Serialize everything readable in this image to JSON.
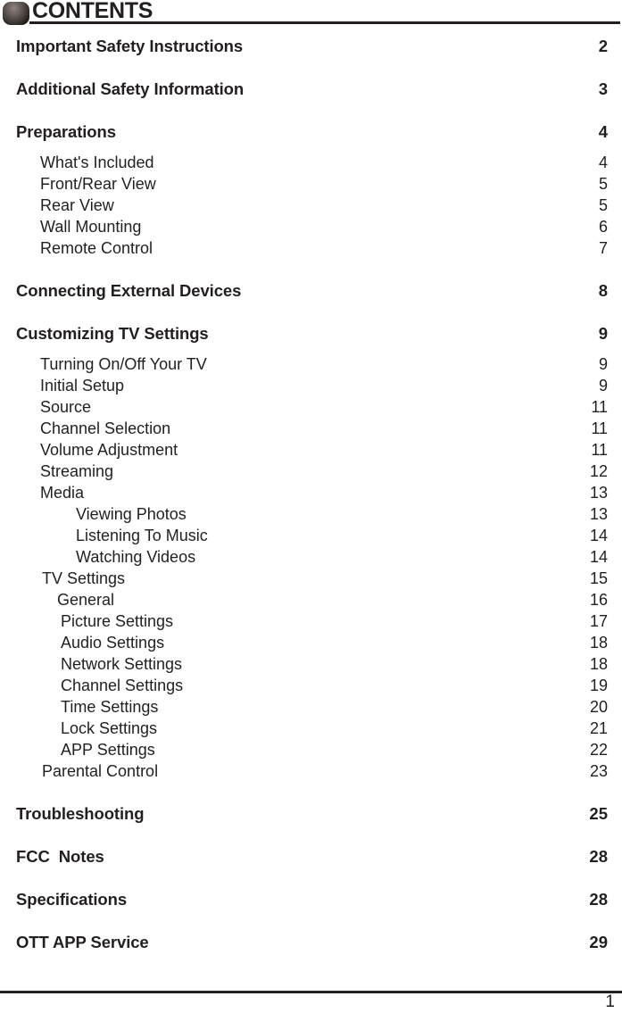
{
  "header": {
    "title": "CONTENTS",
    "icon": "rounded-square-bullet-icon"
  },
  "footer": {
    "page_number": "1"
  },
  "toc": {
    "entries": [
      {
        "label": "Important Safety Instructions",
        "page": "2",
        "level": 0
      },
      {
        "label": "Additional Safety Information",
        "page": "3",
        "level": 0
      },
      {
        "label": "Preparations",
        "page": "4",
        "level": 0
      },
      {
        "label": "What's Included",
        "page": "4",
        "level": 1
      },
      {
        "label": "Front/Rear View",
        "page": "5",
        "level": 1
      },
      {
        "label": "Rear View",
        "page": "5",
        "level": 1
      },
      {
        "label": "Wall Mounting",
        "page": "6",
        "level": 1
      },
      {
        "label": "Remote Control",
        "page": "7",
        "level": 1
      },
      {
        "label": "Connecting External Devices",
        "page": "8",
        "level": 0
      },
      {
        "label": "Customizing TV Settings",
        "page": "9",
        "level": 0
      },
      {
        "label": "Turning On/Off Your TV",
        "page": "9",
        "level": 1
      },
      {
        "label": "Initial Setup",
        "page": "9",
        "level": 1
      },
      {
        "label": "Source",
        "page": "11",
        "level": 1
      },
      {
        "label": "Channel Selection",
        "page": "11",
        "level": 1
      },
      {
        "label": "Volume Adjustment",
        "page": "11",
        "level": 1
      },
      {
        "label": "Streaming",
        "page": "12",
        "level": 1
      },
      {
        "label": "Media",
        "page": "13",
        "level": 1
      },
      {
        "label": "Viewing Photos",
        "page": "13",
        "level": 2
      },
      {
        "label": "Listening To Music",
        "page": "14",
        "level": 2
      },
      {
        "label": "Watching Videos",
        "page": "14",
        "level": 2
      },
      {
        "label": "TV Settings",
        "page": "15",
        "level": 1
      },
      {
        "label": "General",
        "page": "16",
        "level": 2
      },
      {
        "label": "Picture Settings",
        "page": "17",
        "level": 2
      },
      {
        "label": "Audio Settings",
        "page": "18",
        "level": 2
      },
      {
        "label": "Network Settings",
        "page": "18",
        "level": 2
      },
      {
        "label": "Channel Settings",
        "page": "19",
        "level": 2
      },
      {
        "label": "Time Settings",
        "page": "20",
        "level": 2
      },
      {
        "label": "Lock Settings",
        "page": "21",
        "level": 2
      },
      {
        "label": "APP Settings",
        "page": "22",
        "level": 2
      },
      {
        "label": "Parental Control",
        "page": "23",
        "level": 1
      },
      {
        "label": "Troubleshooting",
        "page": "25",
        "level": 0
      },
      {
        "label": "FCC  Notes",
        "page": "28",
        "level": 0
      },
      {
        "label": "Specifications",
        "page": "28",
        "level": 0
      },
      {
        "label": "OTT APP Service",
        "page": "29",
        "level": 0
      }
    ]
  }
}
